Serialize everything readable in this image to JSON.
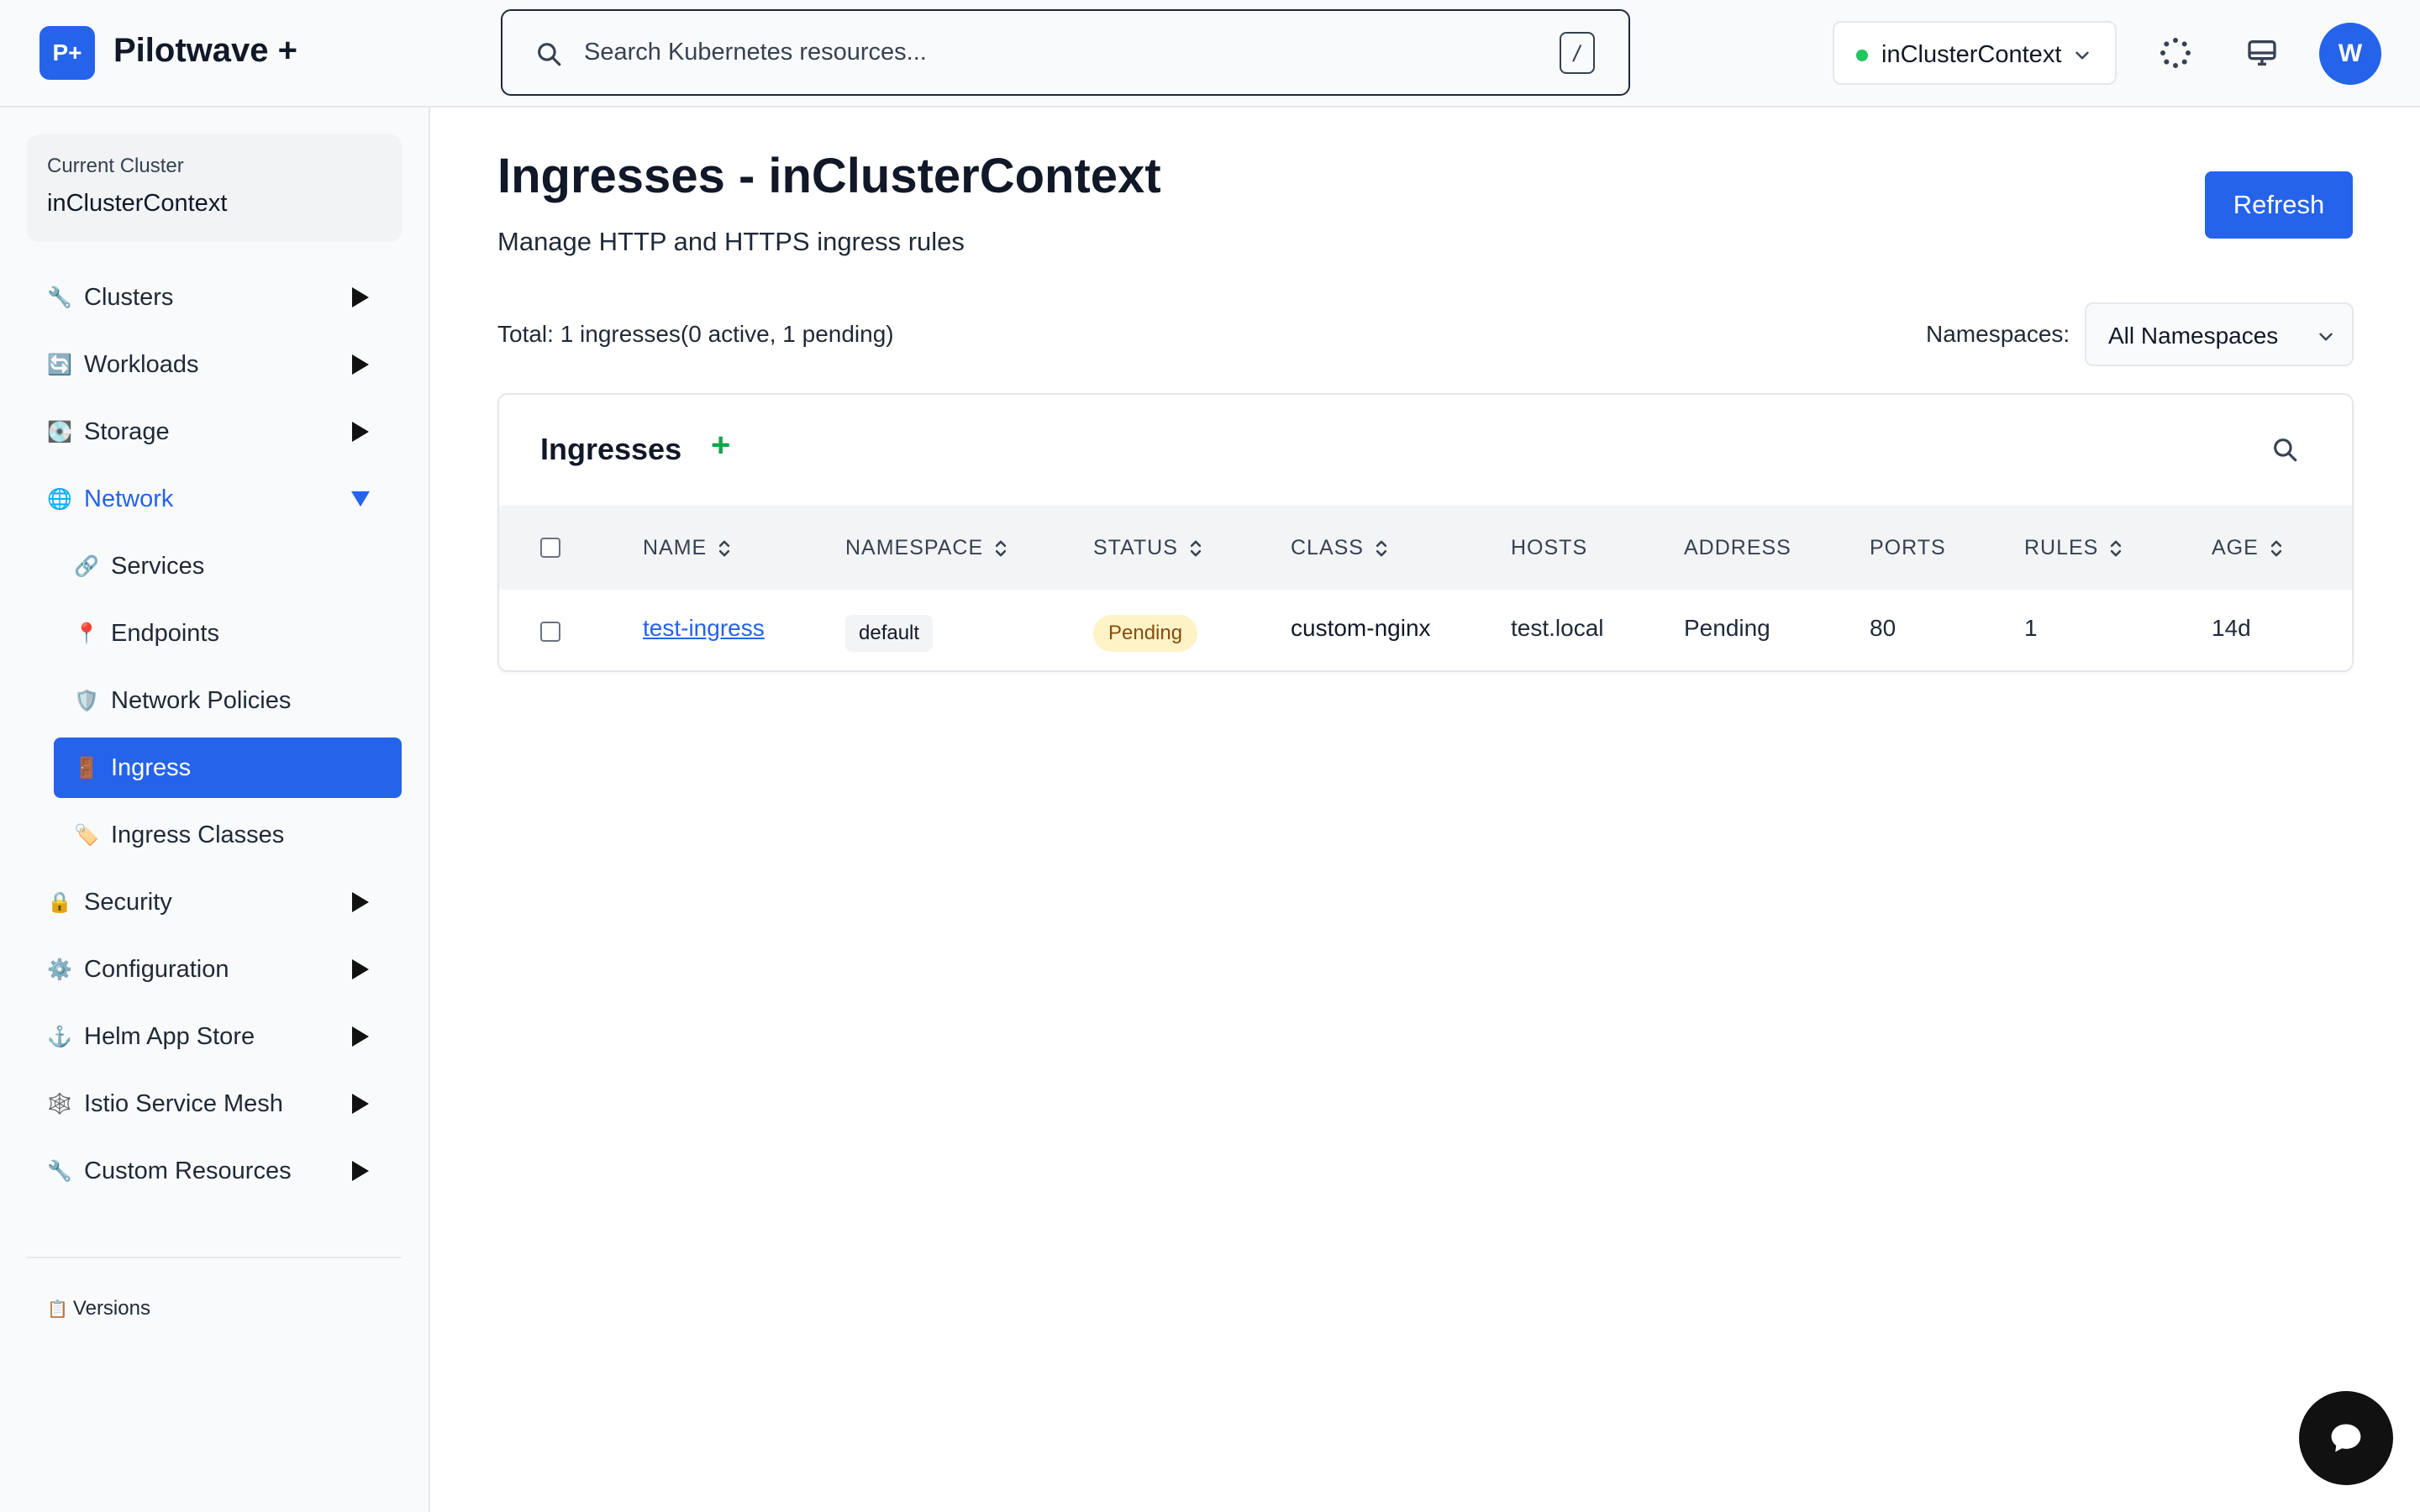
{
  "app": {
    "logo_text": "P+",
    "title": "Pilotwave +"
  },
  "search": {
    "placeholder": "Search Kubernetes resources...",
    "shortcut": "/"
  },
  "context_selector": {
    "value": "inClusterContext",
    "status_color": "#22c55e"
  },
  "header_icons": [
    "loading-spinner-icon",
    "monitor-icon"
  ],
  "user": {
    "initial": "W"
  },
  "sidebar": {
    "current_cluster_label": "Current Cluster",
    "current_cluster_value": "inClusterContext",
    "items": [
      {
        "label": "Clusters",
        "icon": "🔧",
        "expanded": false
      },
      {
        "label": "Workloads",
        "icon": "🔄",
        "expanded": false
      },
      {
        "label": "Storage",
        "icon": "💽",
        "expanded": false
      },
      {
        "label": "Network",
        "icon": "🌐",
        "expanded": true
      },
      {
        "label": "Security",
        "icon": "🔒",
        "expanded": false
      },
      {
        "label": "Configuration",
        "icon": "⚙️",
        "expanded": false
      },
      {
        "label": "Helm App Store",
        "icon": "⚓",
        "expanded": false
      },
      {
        "label": "Istio Service Mesh",
        "icon": "🕸️",
        "expanded": false
      },
      {
        "label": "Custom Resources",
        "icon": "🔧",
        "expanded": false
      }
    ],
    "network_children": [
      {
        "label": "Services",
        "icon": "🔗",
        "active": false
      },
      {
        "label": "Endpoints",
        "icon": "📍",
        "active": false
      },
      {
        "label": "Network Policies",
        "icon": "🛡️",
        "active": false
      },
      {
        "label": "Ingress",
        "icon": "🚪",
        "active": true
      },
      {
        "label": "Ingress Classes",
        "icon": "🏷️",
        "active": false
      }
    ],
    "versions_label": "Versions",
    "versions_icon": "📋"
  },
  "page": {
    "title": "Ingresses - inClusterContext",
    "subtitle": "Manage HTTP and HTTPS ingress rules",
    "refresh_label": "Refresh",
    "total_text": "Total: 1 ingresses(0 active, 1 pending)",
    "namespaces_label": "Namespaces:",
    "namespaces_value": "All Namespaces"
  },
  "table": {
    "title": "Ingresses",
    "add_symbol": "+",
    "columns": [
      {
        "label": "NAME",
        "sortable": true
      },
      {
        "label": "NAMESPACE",
        "sortable": true
      },
      {
        "label": "STATUS",
        "sortable": true
      },
      {
        "label": "CLASS",
        "sortable": true
      },
      {
        "label": "HOSTS",
        "sortable": false
      },
      {
        "label": "ADDRESS",
        "sortable": false
      },
      {
        "label": "PORTS",
        "sortable": false
      },
      {
        "label": "RULES",
        "sortable": true
      },
      {
        "label": "AGE",
        "sortable": true
      }
    ],
    "rows": [
      {
        "name": "test-ingress",
        "namespace": "default",
        "status": "Pending",
        "class": "custom-nginx",
        "hosts": "test.local",
        "address": "Pending",
        "ports": "80",
        "rules": "1",
        "age": "14d"
      }
    ]
  },
  "colors": {
    "accent": "#2563eb",
    "pending_bg": "#fef3c7",
    "pending_text": "#854d0e",
    "add_green": "#16a34a"
  }
}
